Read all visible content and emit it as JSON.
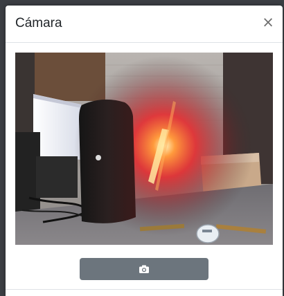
{
  "modal": {
    "title": "Cámara",
    "close_label": "×"
  },
  "camera": {
    "icon": "camera-icon",
    "feed": "live-camera-preview"
  },
  "colors": {
    "button_bg": "#6c757d",
    "backdrop": "#3b3e43"
  }
}
